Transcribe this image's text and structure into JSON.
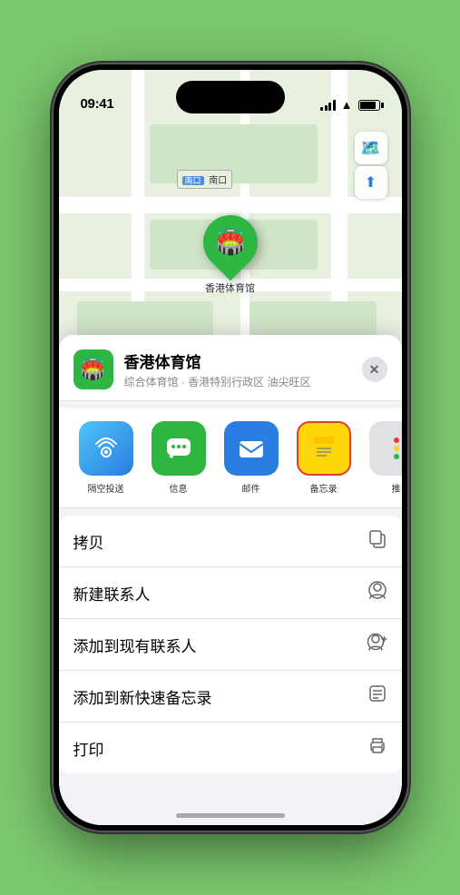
{
  "status_bar": {
    "time": "09:41",
    "signal_label": "signal",
    "wifi_label": "wifi",
    "battery_label": "battery"
  },
  "map": {
    "label": "南口",
    "pin_label": "香港体育馆",
    "pin_emoji": "🏟️"
  },
  "map_controls": {
    "layers_icon": "🗺️",
    "location_icon": "↗"
  },
  "sheet": {
    "venue_emoji": "🏟️",
    "venue_name": "香港体育馆",
    "venue_subtitle": "综合体育馆 · 香港特别行政区 油尖旺区",
    "close_label": "✕"
  },
  "share_items": [
    {
      "id": "airdrop",
      "label": "隔空投送",
      "emoji": "📡",
      "style": "airdrop"
    },
    {
      "id": "messages",
      "label": "信息",
      "emoji": "💬",
      "style": "messages"
    },
    {
      "id": "mail",
      "label": "邮件",
      "emoji": "✉️",
      "style": "mail"
    },
    {
      "id": "notes",
      "label": "备忘录",
      "emoji": "📋",
      "style": "notes"
    },
    {
      "id": "more",
      "label": "推",
      "emoji": "···",
      "style": "more"
    }
  ],
  "actions": [
    {
      "id": "copy",
      "label": "拷贝",
      "icon": "⧉"
    },
    {
      "id": "new-contact",
      "label": "新建联系人",
      "icon": "👤"
    },
    {
      "id": "add-existing",
      "label": "添加到现有联系人",
      "icon": "👤+"
    },
    {
      "id": "add-notes",
      "label": "添加到新快速备忘录",
      "icon": "🗒"
    },
    {
      "id": "print",
      "label": "打印",
      "icon": "🖨"
    }
  ]
}
